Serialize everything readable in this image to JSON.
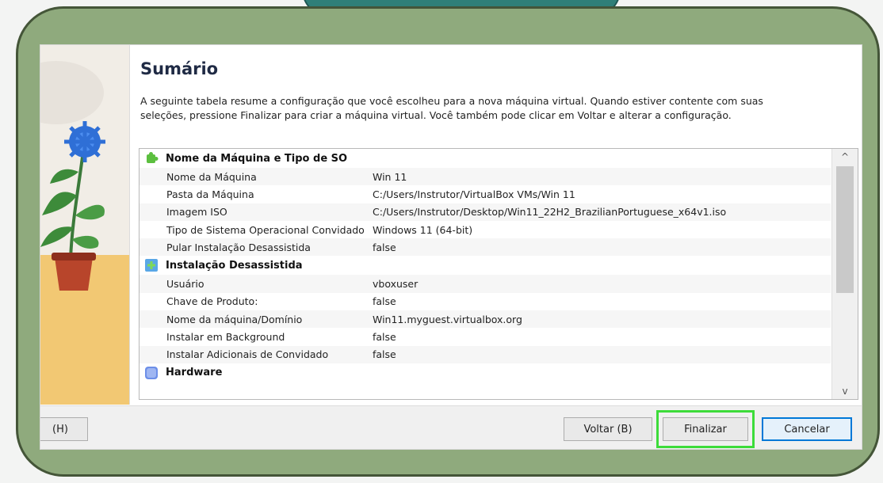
{
  "wizard": {
    "title": "Sumário",
    "description": "A seguinte tabela resume a configuração que você escolheu para a nova máquina virtual. Quando estiver contente com suas seleções, pressione Finalizar para criar a máquina virtual. Você também pode clicar em Voltar e alterar a configuração."
  },
  "sections": [
    {
      "title": "Nome da Máquina e Tipo de SO",
      "icon": "green-puzzle-icon",
      "rows": [
        {
          "key": "Nome da Máquina",
          "value": "Win 11"
        },
        {
          "key": "Pasta da Máquina",
          "value": "C:/Users/Instrutor/VirtualBox VMs/Win 11"
        },
        {
          "key": "Imagem ISO",
          "value": "C:/Users/Instrutor/Desktop/Win11_22H2_BrazilianPortuguese_x64v1.iso"
        },
        {
          "key": "Tipo de Sistema Operacional Convidado",
          "value": "Windows 11 (64-bit)"
        },
        {
          "key": "Pular Instalação Desassistida",
          "value": "false"
        }
      ]
    },
    {
      "title": "Instalação Desassistida",
      "icon": "install-plus-icon",
      "rows": [
        {
          "key": "Usuário",
          "value": "vboxuser"
        },
        {
          "key": "Chave de Produto:",
          "value": "false"
        },
        {
          "key": "Nome da máquina/Domínio",
          "value": "Win11.myguest.virtualbox.org"
        },
        {
          "key": "Instalar em Background",
          "value": "false"
        },
        {
          "key": "Instalar Adicionais de Convidado",
          "value": "false"
        }
      ]
    },
    {
      "title": "Hardware",
      "icon": "hardware-chip-icon",
      "rows": []
    }
  ],
  "buttons": {
    "help": "(H)",
    "back": "Voltar (B)",
    "finish": "Finalizar",
    "cancel": "Cancelar"
  },
  "scrollbar": {
    "up_glyph": "^",
    "down_glyph": "v"
  },
  "colors": {
    "frame": "#8faa7d",
    "highlight": "#3ddc3a",
    "primary_border": "#0078d7"
  }
}
